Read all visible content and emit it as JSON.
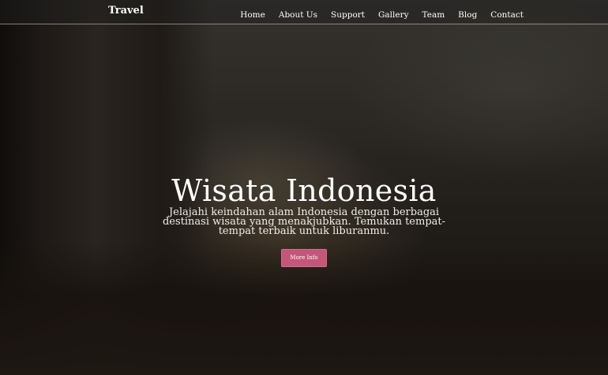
{
  "navbar": {
    "brand": "Travel",
    "links": [
      "Home",
      "About Us",
      "Support",
      "Gallery",
      "Team",
      "Blog",
      "Contact"
    ]
  },
  "hero": {
    "title": "Wisata Indonesia",
    "subtitle": "Jelajahi keindahan alam Indonesia dengan berbagai destinasi wisata yang menakjubkan. Temukan tempat-tempat terbaik untuk liburanmu.",
    "button_label": "More Info"
  },
  "colors": {
    "accent": "#c45679",
    "text": "#ffffff"
  }
}
